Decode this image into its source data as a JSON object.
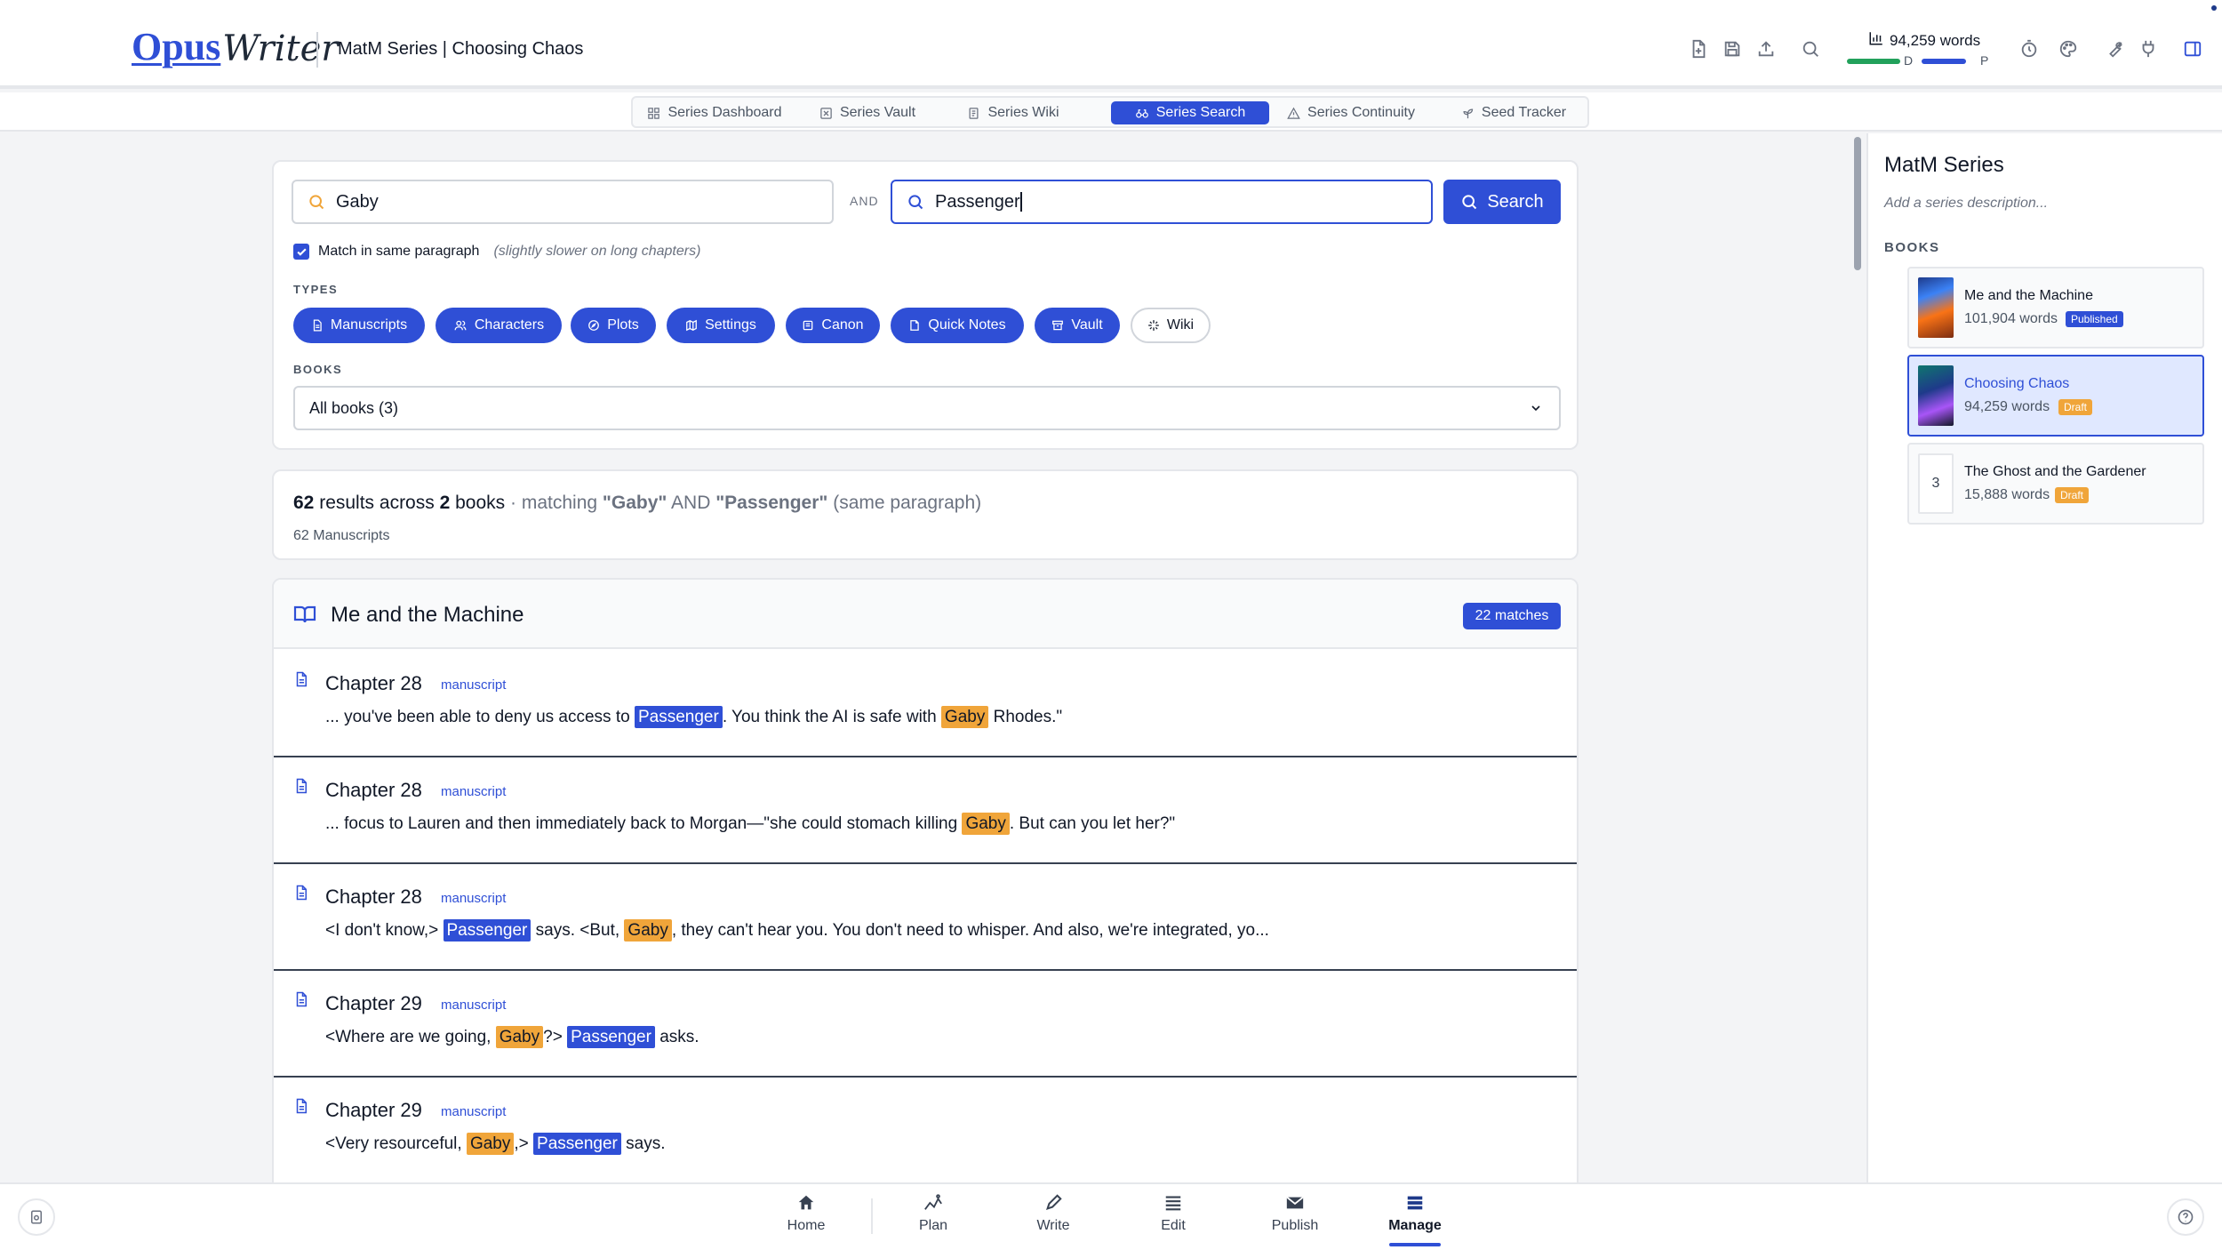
{
  "app": {
    "logo_main": "Opus",
    "logo_script": "Writer",
    "title": "MatM Series | Choosing Chaos"
  },
  "header": {
    "word_count": "94,259 words",
    "draft_label": "D",
    "publish_label": "P",
    "icons": [
      "file-plus-icon",
      "save-icon",
      "upload-icon",
      "search-icon",
      "chart-icon",
      "timer-icon",
      "palette-icon",
      "wrench-icon",
      "plug-icon",
      "panel-icon"
    ]
  },
  "subnav": {
    "tabs": [
      {
        "label": "Series Dashboard",
        "icon": "grid-icon"
      },
      {
        "label": "Series Vault",
        "icon": "vault-icon"
      },
      {
        "label": "Series Wiki",
        "icon": "page-icon"
      },
      {
        "label": "Series Search",
        "icon": "binoculars-icon",
        "active": true
      },
      {
        "label": "Series Continuity",
        "icon": "warning-icon"
      },
      {
        "label": "Seed Tracker",
        "icon": "sprout-icon"
      }
    ]
  },
  "search": {
    "term1": "Gaby",
    "and_label": "AND",
    "term2": "Passenger",
    "button_label": "Search",
    "same_paragraph_label": "Match in same paragraph",
    "same_paragraph_hint": "(slightly slower on long chapters)",
    "same_paragraph_checked": true,
    "types_label": "TYPES",
    "types": [
      {
        "label": "Manuscripts",
        "active": true
      },
      {
        "label": "Characters",
        "active": true
      },
      {
        "label": "Plots",
        "active": true
      },
      {
        "label": "Settings",
        "active": true
      },
      {
        "label": "Canon",
        "active": true
      },
      {
        "label": "Quick Notes",
        "active": true
      },
      {
        "label": "Vault",
        "active": true
      },
      {
        "label": "Wiki",
        "active": false
      }
    ],
    "books_label": "BOOKS",
    "books_selected": "All books (3)"
  },
  "summary": {
    "count": "62",
    "results_across": "results across",
    "books_count": "2",
    "books_word": "books",
    "matching": "· matching",
    "term1_quoted": "\"Gaby\"",
    "and_word": "AND",
    "term2_quoted": "\"Passenger\"",
    "scope": "(same paragraph)",
    "breakdown": "62 Manuscripts"
  },
  "results": {
    "book_title": "Me and the Machine",
    "matches_badge": "22 matches",
    "items": [
      {
        "chapter": "Chapter 28",
        "type": "manuscript",
        "segments": [
          {
            "t": "... you've been able to deny us access to "
          },
          {
            "t": "Passenger",
            "h": "b"
          },
          {
            "t": ". You think the AI is safe with "
          },
          {
            "t": "Gaby",
            "h": "o"
          },
          {
            "t": " Rhodes.\""
          }
        ]
      },
      {
        "chapter": "Chapter 28",
        "type": "manuscript",
        "segments": [
          {
            "t": "... focus to Lauren and then immediately back to Morgan—\"she could stomach killing "
          },
          {
            "t": "Gaby",
            "h": "o"
          },
          {
            "t": ". But can you let her?\""
          }
        ]
      },
      {
        "chapter": "Chapter 28",
        "type": "manuscript",
        "segments": [
          {
            "t": "<I don't know,> "
          },
          {
            "t": "Passenger",
            "h": "b"
          },
          {
            "t": " says. <But, "
          },
          {
            "t": "Gaby",
            "h": "o"
          },
          {
            "t": ", they can't hear you. You don't need to whisper. And also, we're integrated, yo..."
          }
        ]
      },
      {
        "chapter": "Chapter 29",
        "type": "manuscript",
        "segments": [
          {
            "t": "<Where are we going, "
          },
          {
            "t": "Gaby",
            "h": "o"
          },
          {
            "t": "?> "
          },
          {
            "t": "Passenger",
            "h": "b"
          },
          {
            "t": " asks."
          }
        ]
      },
      {
        "chapter": "Chapter 29",
        "type": "manuscript",
        "segments": [
          {
            "t": "<Very resourceful, "
          },
          {
            "t": "Gaby",
            "h": "o"
          },
          {
            "t": ",> "
          },
          {
            "t": "Passenger",
            "h": "b"
          },
          {
            "t": " says."
          }
        ]
      }
    ]
  },
  "series_panel": {
    "title": "MatM Series",
    "description_placeholder": "Add a series description...",
    "books_label": "BOOKS",
    "books": [
      {
        "title": "Me and the Machine",
        "words": "101,904 words",
        "status": "Published",
        "cover": "c1"
      },
      {
        "title": "Choosing Chaos",
        "words": "94,259 words",
        "status": "Draft",
        "cover": "c2",
        "selected": true
      },
      {
        "title": "The Ghost and the Gardener",
        "words": "15,888 words",
        "status": "Draft",
        "cover_number": "3"
      }
    ]
  },
  "bottom_nav": {
    "items": [
      {
        "label": "Home",
        "icon": "home-icon"
      },
      {
        "label": "Plan",
        "icon": "plan-icon"
      },
      {
        "label": "Write",
        "icon": "pen-icon"
      },
      {
        "label": "Edit",
        "icon": "list-icon"
      },
      {
        "label": "Publish",
        "icon": "mail-icon"
      },
      {
        "label": "Manage",
        "icon": "stack-icon",
        "active": true
      }
    ]
  },
  "colors": {
    "accent": "#2f4fd6",
    "highlight_term1": "#f0a53a",
    "highlight_term2": "#2f4fd6",
    "draft_bar": "#22a15b"
  }
}
